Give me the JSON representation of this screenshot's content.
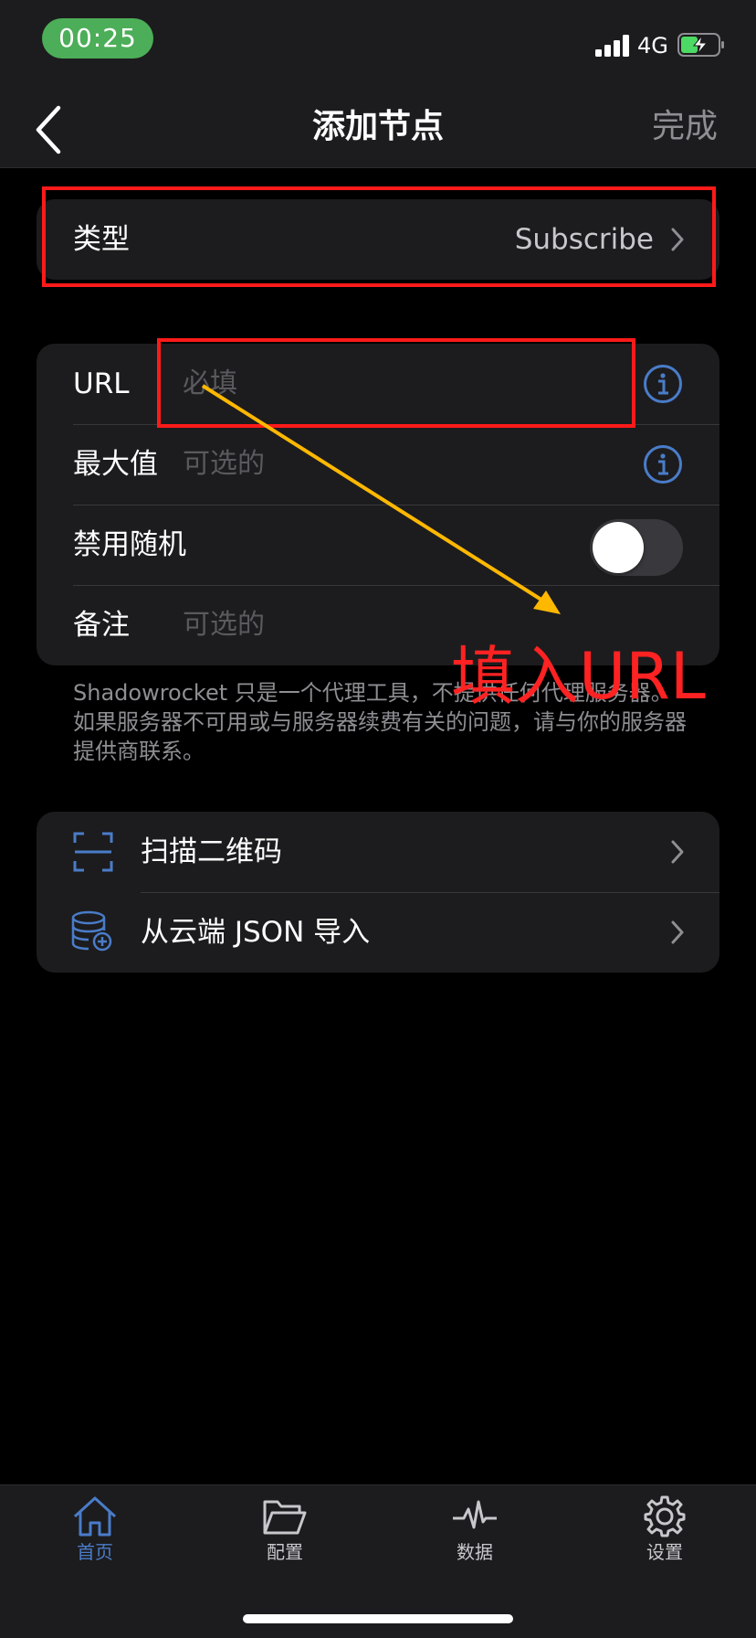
{
  "status_bar": {
    "time": "00:25",
    "network": "4G"
  },
  "nav": {
    "title": "添加节点",
    "done": "完成"
  },
  "type_row": {
    "label": "类型",
    "value": "Subscribe"
  },
  "form": {
    "url": {
      "label": "URL",
      "placeholder": "必填"
    },
    "max": {
      "label": "最大值",
      "placeholder": "可选的"
    },
    "random": {
      "label": "禁用随机",
      "enabled": false
    },
    "note": {
      "label": "备注",
      "placeholder": "可选的"
    }
  },
  "footnote": "Shadowrocket 只是一个代理工具，不提供任何代理服务器。如果服务器不可用或与服务器续费有关的问题，请与你的服务器提供商联系。",
  "actions": {
    "scan": {
      "label": "扫描二维码",
      "icon": "qr-scan-icon"
    },
    "json": {
      "label": "从云端 JSON 导入",
      "icon": "database-add-icon"
    }
  },
  "annotation": {
    "text": "填入URL",
    "color": "#ff2222",
    "arrow_color": "#ffb800"
  },
  "tabbar": {
    "items": [
      {
        "label": "首页",
        "icon": "home-icon",
        "active": true
      },
      {
        "label": "配置",
        "icon": "folder-icon",
        "active": false
      },
      {
        "label": "数据",
        "icon": "activity-icon",
        "active": false
      },
      {
        "label": "设置",
        "icon": "gear-icon",
        "active": false
      }
    ]
  },
  "colors": {
    "accent": "#4a7cc9",
    "status_pill": "#4cae58",
    "battery_charge": "#4cd964"
  }
}
